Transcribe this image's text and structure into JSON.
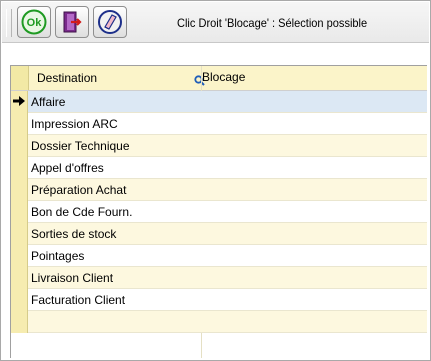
{
  "toolbar": {
    "buttons": [
      {
        "label": "Ok",
        "icon": "ok-icon"
      },
      {
        "icon": "exit-door-icon"
      },
      {
        "icon": "eraser-icon"
      }
    ],
    "message": "Clic Droit 'Blocage' : Sélection possible"
  },
  "grid": {
    "columns": [
      "Destination",
      "Blocage"
    ],
    "rows": [
      {
        "destination": "Affaire",
        "blocage": "",
        "current": true
      },
      {
        "destination": "Impression ARC",
        "blocage": ""
      },
      {
        "destination": "Dossier Technique",
        "blocage": ""
      },
      {
        "destination": "Appel d'offres",
        "blocage": ""
      },
      {
        "destination": "Préparation Achat",
        "blocage": ""
      },
      {
        "destination": "Bon de Cde Fourn.",
        "blocage": ""
      },
      {
        "destination": "Sorties de stock",
        "blocage": ""
      },
      {
        "destination": "Pointages",
        "blocage": ""
      },
      {
        "destination": "Livraison Client",
        "blocage": ""
      },
      {
        "destination": "Facturation Client",
        "blocage": ""
      },
      {
        "destination": "",
        "blocage": ""
      }
    ]
  },
  "colors": {
    "header_bg": "#fbf4c9",
    "row_alt": "#fdf8df",
    "selected_row": "#dce8f4",
    "ok_green": "#1e9a22"
  }
}
